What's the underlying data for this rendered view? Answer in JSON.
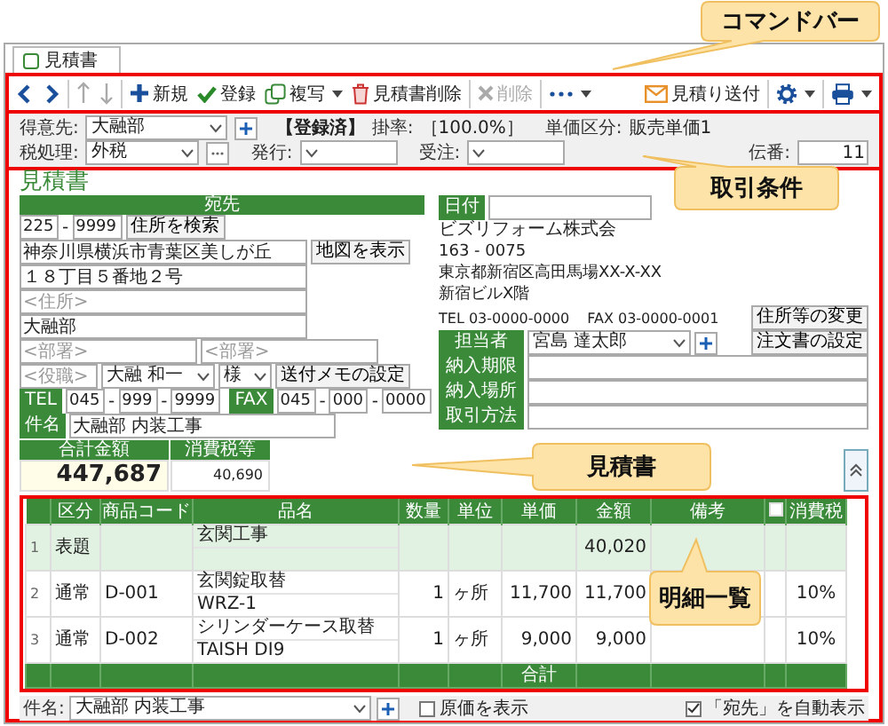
{
  "tab": {
    "label": "見積書",
    "selected": true
  },
  "command_bar": [
    {
      "kind": "back",
      "disabled": false
    },
    {
      "kind": "forward",
      "disabled": false
    },
    {
      "kind": "separator"
    },
    {
      "kind": "up",
      "disabled": true
    },
    {
      "kind": "down",
      "disabled": true
    },
    {
      "kind": "separator"
    },
    {
      "kind": "new",
      "label": "新規",
      "disabled": false
    },
    {
      "kind": "save",
      "label": "登録",
      "disabled": false
    },
    {
      "kind": "copy",
      "label": "複写",
      "menu": true,
      "disabled": false
    },
    {
      "kind": "delete-doc",
      "label": "見積書削除",
      "disabled": false
    },
    {
      "kind": "separator"
    },
    {
      "kind": "delete",
      "label": "削除",
      "disabled": true
    },
    {
      "kind": "separator"
    },
    {
      "kind": "more",
      "menu": true,
      "disabled": false
    },
    {
      "kind": "spacer"
    },
    {
      "kind": "mail",
      "label": "見積り送付",
      "disabled": false
    },
    {
      "kind": "separator"
    },
    {
      "kind": "settings",
      "menu": true,
      "disabled": false
    },
    {
      "kind": "separator"
    },
    {
      "kind": "print",
      "menu": true,
      "disabled": false
    }
  ],
  "conditions": {
    "customer": {
      "label": "得意先:",
      "value": "大融部"
    },
    "status": "【登録済】",
    "rate": {
      "label": "掛率:",
      "value": "［100.0%］"
    },
    "price_class": {
      "label": "単価区分:",
      "value": "販売単価1"
    },
    "tax": {
      "label": "税処理:",
      "value": "外税"
    },
    "issued": {
      "label": "発行:"
    },
    "ordered": {
      "label": "受注:"
    },
    "slip_no": {
      "label": "伝番:",
      "value": "11"
    }
  },
  "document": {
    "title": "見積書",
    "recipient": {
      "header": "宛先",
      "zip": [
        "225",
        "9999"
      ],
      "zip_separator": "-",
      "search_button": "住所を検索",
      "address1": "神奈川県横浜市青葉区美しが丘",
      "map_button": "地図を表示",
      "address2": "１８丁目５番地２号",
      "address3_placeholder": "<住所>",
      "company": "大融部",
      "department_placeholders": [
        "<部署>",
        "<部署>"
      ],
      "position_placeholder": "<役職>",
      "person": "大融 和一",
      "honorific": "様",
      "memo_button": "送付メモの設定",
      "tel_label": "TEL",
      "tel": [
        "045",
        "999",
        "9999"
      ],
      "fax_label": "FAX",
      "fax": [
        "045",
        "000",
        "0000"
      ],
      "phone_separator": "-"
    },
    "subject": {
      "label": "件名",
      "value": "大融部 内装工事"
    },
    "totals": [
      {
        "label": "合計金額",
        "value": "447,687"
      },
      {
        "label": "消費税等",
        "value": "40,690"
      }
    ],
    "sender": {
      "date_label": "日付",
      "company": "ビズリフォーム株式会",
      "zip": "163 - 0075",
      "address": "東京都新宿区高田馬場XX-X-XX",
      "building": "新宿ビルX階",
      "tel": "TEL 03-0000-0000",
      "fax": "FAX 03-0000-0001",
      "change_button": "住所等の変更",
      "staff_label": "担当者",
      "staff": "宮島 達太郎",
      "order_button": "注文書の設定",
      "fields": [
        {
          "label": "納入期限"
        },
        {
          "label": "納入場所"
        },
        {
          "label": "取引方法"
        }
      ]
    }
  },
  "table": {
    "columns": [
      {
        "kind": "index"
      },
      {
        "kind": "text",
        "label": "区分"
      },
      {
        "kind": "text",
        "label": "商品コード"
      },
      {
        "kind": "text",
        "label": "品名"
      },
      {
        "kind": "text",
        "label": "数量"
      },
      {
        "kind": "text",
        "label": "単位"
      },
      {
        "kind": "text",
        "label": "単価"
      },
      {
        "kind": "text",
        "label": "金額"
      },
      {
        "kind": "text",
        "label": "備考"
      },
      {
        "kind": "check"
      },
      {
        "kind": "text",
        "label": "消費税"
      }
    ],
    "rows": [
      {
        "kind": "heading",
        "no": "1",
        "category": "表題",
        "name": "玄関工事",
        "amount": "40,020"
      },
      {
        "kind": "normal",
        "no": "2",
        "category": "通常",
        "code": "D-001",
        "name": "玄関錠取替",
        "spec": "WRZ-1",
        "qty": "1",
        "unit": "ヶ所",
        "price": "11,700",
        "amount": "11,700",
        "tax": "10%"
      },
      {
        "kind": "normal",
        "no": "3",
        "category": "通常",
        "code": "D-002",
        "name": "シリンダーケース取替",
        "spec": "TAISH DI9",
        "qty": "1",
        "unit": "ヶ所",
        "price": "9,000",
        "amount": "9,000",
        "tax": "10%"
      }
    ],
    "footer_label": "合計"
  },
  "bottom_bar": {
    "subject_label": "件名:",
    "subject": "大融部 内装工事",
    "show_cost": {
      "label": "原価を表示",
      "checked": false
    },
    "auto_show": {
      "label": "「宛先」を自動表示",
      "checked": true
    }
  },
  "callouts": [
    {
      "label": "コマンドバー"
    },
    {
      "label": "取引条件"
    },
    {
      "label": "見積書"
    },
    {
      "label": "明細一覧"
    }
  ]
}
